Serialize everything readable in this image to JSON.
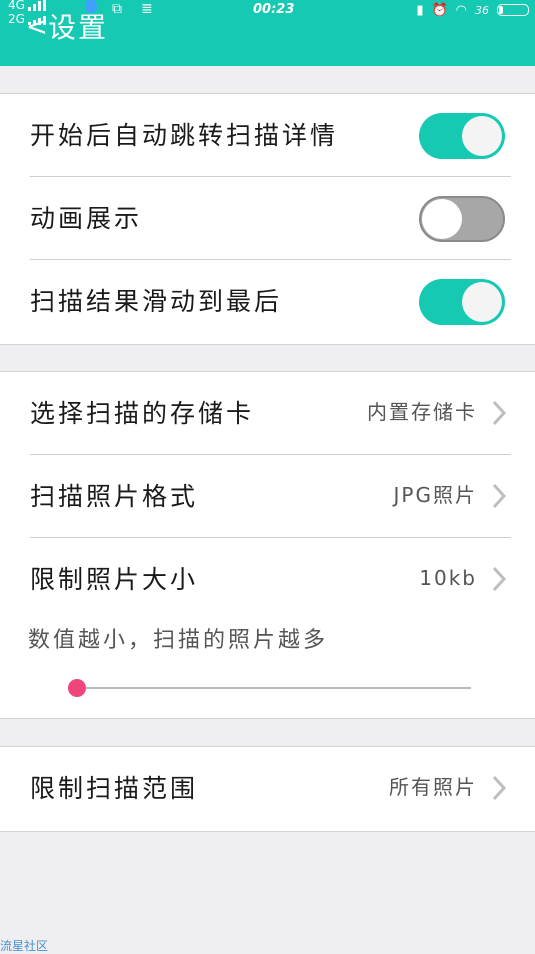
{
  "status_bar": {
    "network_top": "4G",
    "network_bottom": "2G",
    "time": "00:23",
    "signal_right": "36",
    "battery_level": 0.15
  },
  "header": {
    "back_glyph": "<",
    "title": "设置"
  },
  "group1": {
    "rows": [
      {
        "label": "开始后自动跳转扫描详情",
        "toggle_on": true
      },
      {
        "label": "动画展示",
        "toggle_on": false
      },
      {
        "label": "扫描结果滑动到最后",
        "toggle_on": true
      }
    ]
  },
  "group2": {
    "rows": [
      {
        "label": "选择扫描的存储卡",
        "value": "内置存储卡"
      },
      {
        "label": "扫描照片格式",
        "value": "JPG照片"
      },
      {
        "label": "限制照片大小",
        "value": "10kb"
      }
    ],
    "hint": "数值越小，扫描的照片越多",
    "slider_value": 0.0
  },
  "group3": {
    "rows": [
      {
        "label": "限制扫描范围",
        "value": "所有照片"
      }
    ]
  },
  "watermark": "流星社区",
  "colors": {
    "accent": "#15c9b3",
    "slider_thumb": "#f0457a",
    "toggle_off": "#a7a7a7",
    "background": "#efeff1"
  }
}
